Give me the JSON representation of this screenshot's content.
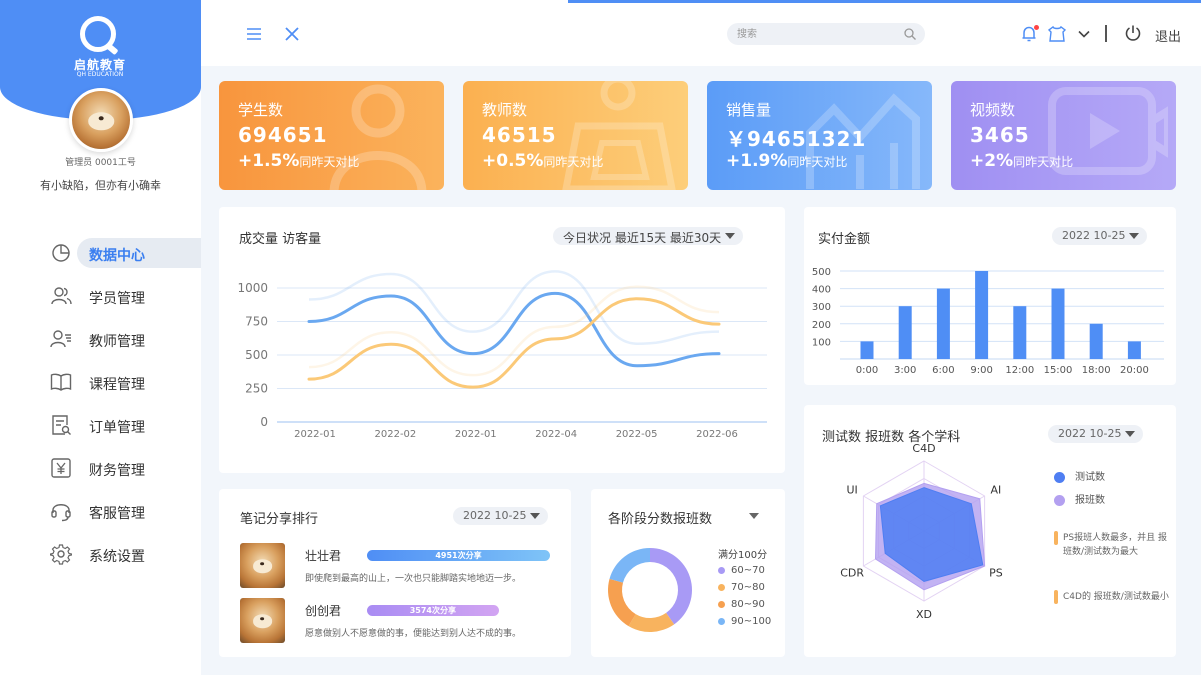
{
  "sidebar": {
    "logo_cn": "启航教育",
    "logo_en": "QH EDUCATION",
    "role": "管理员 0001工号",
    "motto": "有小缺陷，但亦有小确幸",
    "items": [
      {
        "label": "数据中心",
        "icon": "pie-chart-icon"
      },
      {
        "label": "学员管理",
        "icon": "users-icon"
      },
      {
        "label": "教师管理",
        "icon": "teacher-icon"
      },
      {
        "label": "课程管理",
        "icon": "book-icon"
      },
      {
        "label": "订单管理",
        "icon": "order-icon"
      },
      {
        "label": "财务管理",
        "icon": "yuan-icon"
      },
      {
        "label": "客服管理",
        "icon": "headset-icon"
      },
      {
        "label": "系统设置",
        "icon": "gear-icon"
      }
    ]
  },
  "header": {
    "search_placeholder": "搜索",
    "logout": "退出"
  },
  "stats": [
    {
      "label": "学生数",
      "value": "694651",
      "change": "+1.5%",
      "compare": "同昨天对比",
      "color": "#f9a24a"
    },
    {
      "label": "教师数",
      "value": "46515",
      "change": "+0.5%",
      "compare": "同昨天对比",
      "color": "#fbc063"
    },
    {
      "label": "销售量",
      "value": "￥94651321",
      "change": "+1.9%",
      "compare": "同昨天对比",
      "color": "#6aa6f8"
    },
    {
      "label": "视频数",
      "value": "3465",
      "change": "+2%",
      "compare": "同昨天对比",
      "color": "#9e97f3"
    }
  ],
  "line_panel": {
    "title": "成交量 访客量",
    "filters": "今日状况  最近15天  最近30天"
  },
  "bar_panel": {
    "title": "实付金额",
    "date": "2022 10-25"
  },
  "notes_panel": {
    "title": "笔记分享排行",
    "date": "2022 10-25",
    "rows": [
      {
        "name": "壮壮君",
        "count": "4951次分享",
        "text": "即使爬到最高的山上，一次也只能脚踏实地地迈一步。",
        "fill": 1.0
      },
      {
        "name": "创创君",
        "count": "3574次分享",
        "text": "愿意做别人不愿意做的事，便能达到别人达不成的事。",
        "fill": 0.72
      }
    ]
  },
  "donut_panel": {
    "title": "各阶段分数报班数",
    "full_score": "满分100分",
    "legend": [
      "60~70",
      "70~80",
      "80~90",
      "90~100"
    ]
  },
  "radar_panel": {
    "title": "测试数  报班数  各个学科",
    "date": "2022 10-25",
    "legend": [
      "测试数",
      "报班数"
    ],
    "note1": "PS报班人数最多，并且 报班数/测试数为最大",
    "note2": "C4D的 报班数/测试数最小"
  },
  "chart_data": [
    {
      "type": "line",
      "title": "成交量 访客量",
      "x": [
        "2022-01",
        "2022-02",
        "2022-01",
        "2022-04",
        "2022-05",
        "2022-06"
      ],
      "ylim": [
        0,
        1000
      ],
      "yticks": [
        0,
        250,
        500,
        750,
        1000
      ],
      "series": [
        {
          "values": [
            750,
            940,
            510,
            960,
            420,
            510
          ],
          "color": "#6aa8f0"
        },
        {
          "values": [
            320,
            580,
            260,
            620,
            920,
            730
          ],
          "color": "#fbc978"
        }
      ]
    },
    {
      "type": "bar",
      "title": "实付金额",
      "categories": [
        "0:00",
        "3:00",
        "6:00",
        "9:00",
        "12:00",
        "15:00",
        "18:00",
        "20:00"
      ],
      "values": [
        100,
        300,
        400,
        500,
        300,
        400,
        200,
        100
      ],
      "ylim": [
        0,
        500
      ],
      "yticks": [
        100,
        200,
        300,
        400,
        500
      ],
      "color": "#4f8ef5"
    },
    {
      "type": "pie",
      "title": "各阶段分数报班数",
      "categories": [
        "60~70",
        "70~80",
        "80~90",
        "90~100"
      ],
      "values": [
        33,
        15,
        17,
        17
      ],
      "colors": [
        "#a89af5",
        "#f8b35e",
        "#f6a050",
        "#7ab6f6"
      ]
    },
    {
      "type": "radar",
      "title": "测试数  报班数  各个学科",
      "categories": [
        "C4D",
        "AI",
        "PS",
        "XD",
        "CDR",
        "UI"
      ],
      "series": [
        {
          "name": "测试数",
          "values": [
            0.62,
            0.78,
            0.97,
            0.72,
            0.64,
            0.72
          ],
          "color": "#4f7ef2"
        },
        {
          "name": "报班数",
          "values": [
            0.68,
            0.92,
            1.0,
            0.84,
            0.8,
            0.78
          ],
          "color": "#b3a0f0"
        }
      ]
    }
  ]
}
